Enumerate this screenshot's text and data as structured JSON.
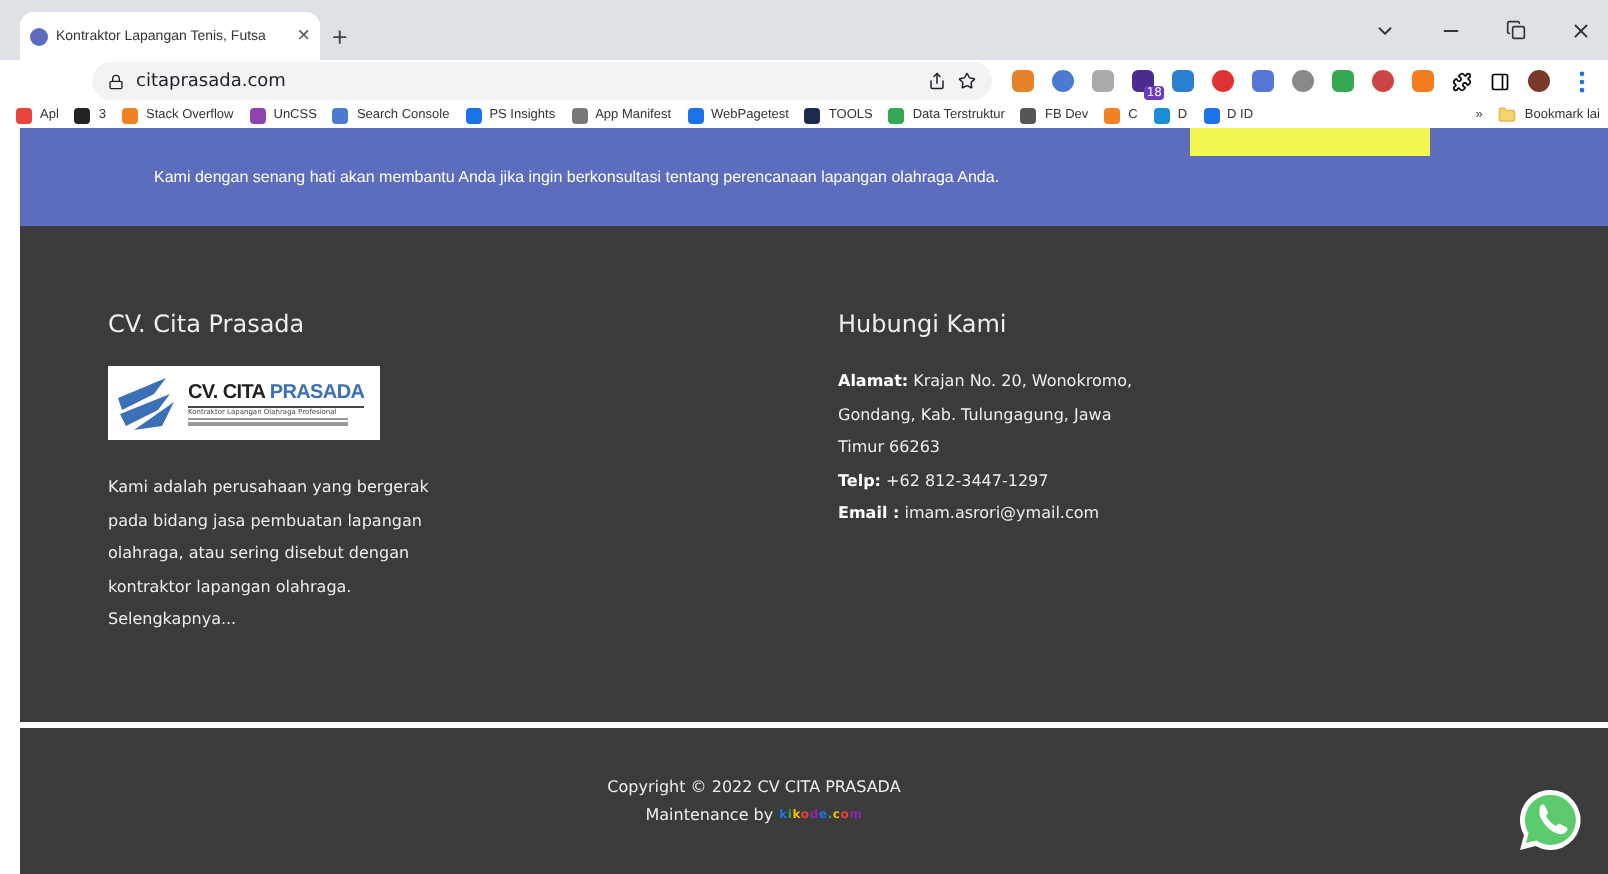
{
  "browser": {
    "tab": {
      "title": "Kontraktor Lapangan Tenis, Futsa",
      "close": "×"
    },
    "new_tab": "+",
    "url": "citaprasada.com",
    "extension_badge": "18",
    "bookmarks": [
      {
        "label": "Apl",
        "color": "#e8453c"
      },
      {
        "label": "3",
        "color": "#222222"
      },
      {
        "label": "Stack Overflow",
        "color": "#f48024"
      },
      {
        "label": "UnCSS",
        "color": "#8e44ad"
      },
      {
        "label": "Search Console",
        "color": "#4a7bd0"
      },
      {
        "label": "PS Insights",
        "color": "#1a73e8"
      },
      {
        "label": "App Manifest",
        "color": "#777777"
      },
      {
        "label": "WebPagetest",
        "color": "#1a73e8"
      },
      {
        "label": "TOOLS",
        "color": "#1b2a4e"
      },
      {
        "label": "Data Terstruktur",
        "color": "#34a853"
      },
      {
        "label": "FB Dev",
        "color": "#555555"
      },
      {
        "label": "C",
        "color": "#f48120"
      },
      {
        "label": "D",
        "color": "#1a8fd8"
      },
      {
        "label": "D ID",
        "color": "#1a73e8"
      }
    ],
    "more": "»",
    "other_bookmarks": "Bookmark lai"
  },
  "banner": {
    "text": "Kami dengan senang hati akan membantu Anda jika ingin berkonsultasi tentang perencanaan lapangan olahraga Anda."
  },
  "about": {
    "title": "CV. Cita Prasada",
    "logo": {
      "name": "CV. CITA ",
      "name_accent": "PRASADA",
      "tagline": "Kontraktor Lapangan Olahraga Profesional"
    },
    "lines": [
      "Kami adalah perusahaan yang bergerak",
      "pada bidang jasa pembuatan lapangan",
      "olahraga, atau sering disebut dengan",
      "kontraktor lapangan olahraga."
    ],
    "more_link": "Selengkapnya..."
  },
  "contact": {
    "title": "Hubungi Kami",
    "lines": [
      "**Alamat:** Krajan No. 20, Wonokromo,",
      "Gondang, Kab. Tulungagung, Jawa",
      "Timur 66263",
      "**Telp:** +62 812-3447-1297",
      "**Email :** imam.asrori@ymail.com"
    ]
  },
  "footer": {
    "copyright": "Copyright © 2022 CV CITA PRASADA",
    "maintenance": "Maintenance by",
    "brand": "kikode.com"
  }
}
